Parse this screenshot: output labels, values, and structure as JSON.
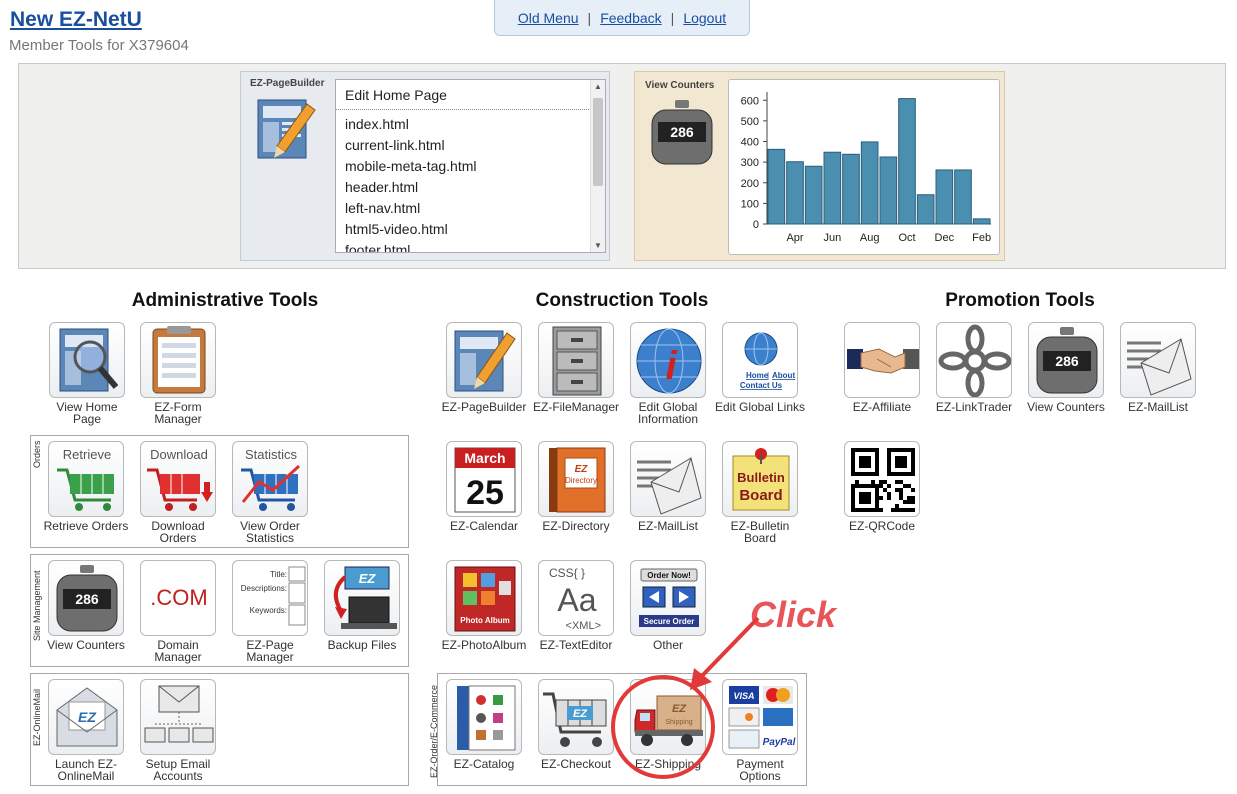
{
  "header": {
    "title": "New EZ-NetU",
    "subtitle": "Member Tools for X379604"
  },
  "topnav": {
    "old_menu": "Old Menu",
    "feedback": "Feedback",
    "logout": "Logout",
    "sep": "|"
  },
  "pagebuilder": {
    "label": "EZ-PageBuilder",
    "head": "Edit Home Page",
    "items": [
      "index.html",
      "current-link.html",
      "mobile-meta-tag.html",
      "header.html",
      "left-nav.html",
      "html5-video.html",
      "footer.html"
    ]
  },
  "counters": {
    "label": "View Counters",
    "digits": "286"
  },
  "chart_data": {
    "type": "bar",
    "values": [
      362,
      302,
      280,
      348,
      338,
      398,
      325,
      608,
      142,
      262,
      262,
      25
    ],
    "x_tick_labels": [
      "Apr",
      "Jun",
      "Aug",
      "Oct",
      "Dec",
      "Feb"
    ],
    "y_ticks": [
      0,
      100,
      200,
      300,
      400,
      500,
      600
    ],
    "ylim": [
      0,
      640
    ],
    "bar_color": "#4a8fb0"
  },
  "sections": {
    "admin": "Administrative Tools",
    "construction": "Construction Tools",
    "promotion": "Promotion Tools"
  },
  "groups": {
    "orders": "Orders",
    "site": "Site Management",
    "mail": "EZ-OnlineMail",
    "ecommerce": "EZ-Order/E-Commerce"
  },
  "admin": {
    "view_home": "View Home Page",
    "form_manager": "EZ-Form Manager",
    "retrieve": "Retrieve Orders",
    "retrieve_ic": "Retrieve",
    "download": "Download Orders",
    "download_ic": "Download",
    "stats": "View Order Statistics",
    "stats_ic": "Statistics",
    "view_counters": "View Counters",
    "domain": "Domain Manager",
    "domain_ic": ".COM",
    "page_manager": "EZ-Page Manager",
    "pm_title": "Title:",
    "pm_desc": "Descriptions:",
    "pm_kw": "Keywords:",
    "backup": "Backup Files",
    "launch_mail": "Launch EZ-OnlineMail",
    "setup_email": "Setup Email Accounts"
  },
  "construction": {
    "pagebuilder": "EZ-PageBuilder",
    "filemanager": "EZ-FileManager",
    "global_info": "Edit Global Information",
    "global_links": "Edit Global Links",
    "gl_home": "Home",
    "gl_about": "About",
    "gl_contact": "Contact Us",
    "calendar": "EZ-Calendar",
    "cal_month": "March",
    "cal_day": "25",
    "directory": "EZ-Directory",
    "dir_ic": "Directory",
    "maillist": "EZ-MailList",
    "bulletin": "EZ-Bulletin Board",
    "bb_ic1": "Bulletin",
    "bb_ic2": "Board",
    "photoalbum": "EZ-PhotoAlbum",
    "photo_ic": "Photo Album",
    "texteditor": "EZ-TextEditor",
    "te_css": "CSS{ }",
    "te_aa": "Aa",
    "te_xml": "<XML>",
    "other": "Other",
    "other_order": "Order Now!",
    "other_secure": "Secure Order",
    "catalog": "EZ-Catalog",
    "checkout": "EZ-Checkout",
    "shipping": "EZ-Shipping",
    "ship_ic": "Shipping",
    "payment": "Payment Options",
    "pay_paypal": "PayPal",
    "pay_visa": "VISA"
  },
  "promotion": {
    "affiliate": "EZ-Affiliate",
    "linktrader": "EZ-LinkTrader",
    "view_counters": "View Counters",
    "maillist": "EZ-MailList",
    "qrcode": "EZ-QRCode"
  },
  "annotation": {
    "click": "Click"
  }
}
